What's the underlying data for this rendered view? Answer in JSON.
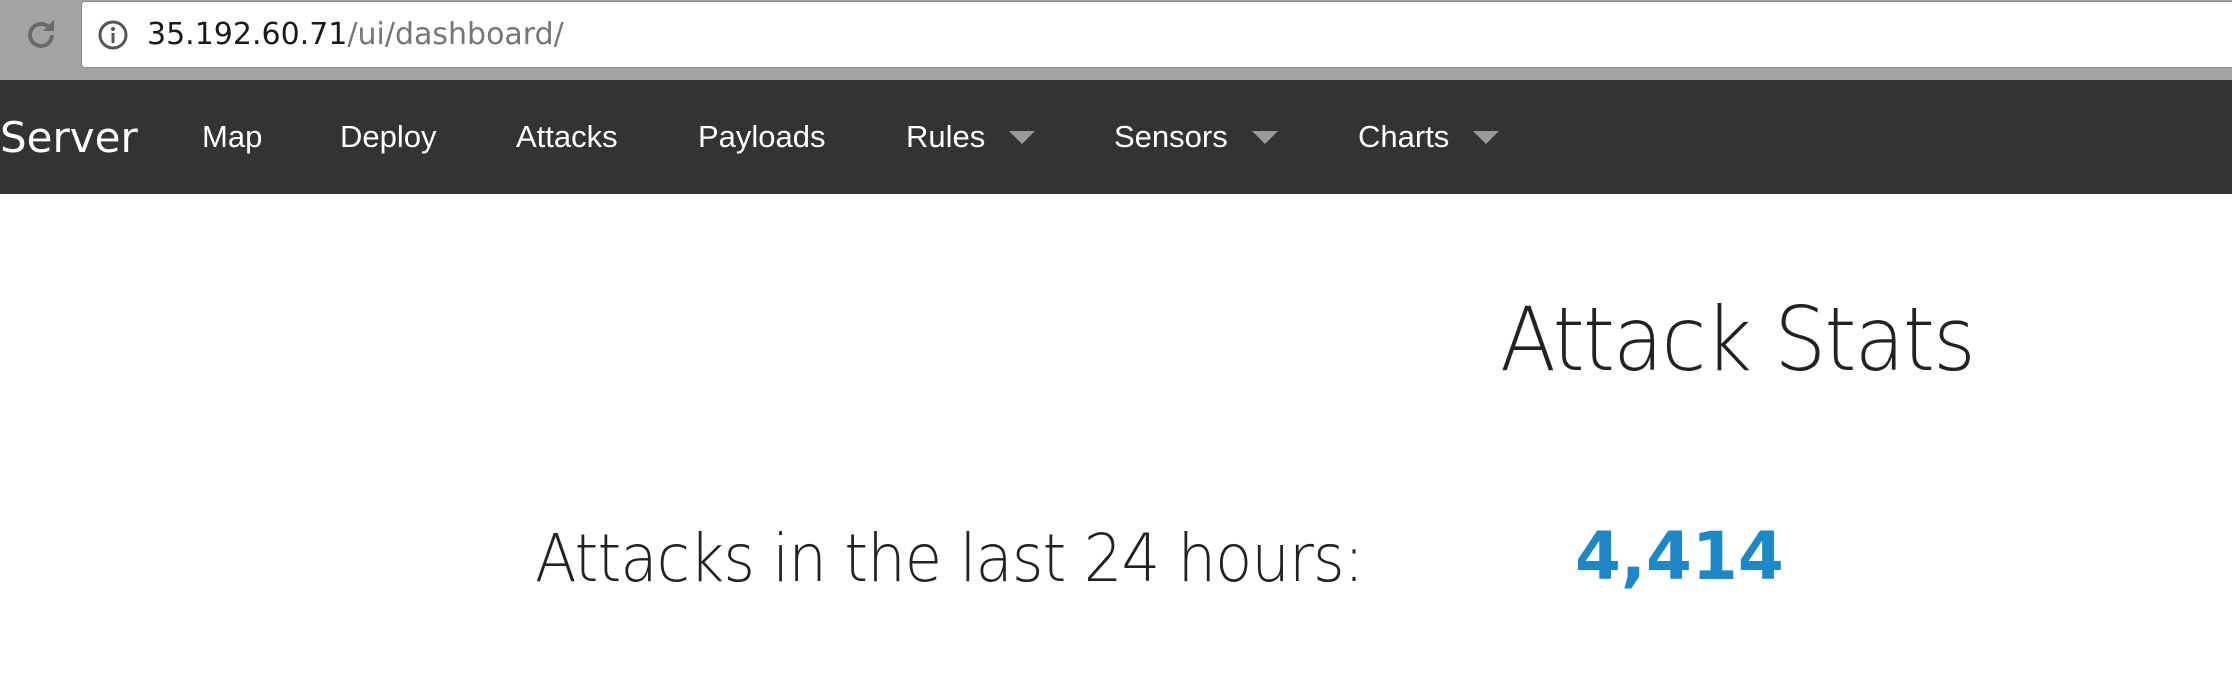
{
  "browser": {
    "url_host": "35.192.60.71",
    "url_path": "/ui/dashboard/"
  },
  "navbar": {
    "brand": "Server",
    "items": [
      {
        "label": "Map",
        "dropdown": false
      },
      {
        "label": "Deploy",
        "dropdown": false
      },
      {
        "label": "Attacks",
        "dropdown": false
      },
      {
        "label": "Payloads",
        "dropdown": false
      },
      {
        "label": "Rules",
        "dropdown": true
      },
      {
        "label": "Sensors",
        "dropdown": true
      },
      {
        "label": "Charts",
        "dropdown": true
      }
    ],
    "background": "#333333",
    "text_color": "#ffffff"
  },
  "main": {
    "title": "Attack Stats",
    "stat_label": "Attacks in the last 24 hours:",
    "stat_value": "4,414",
    "stat_value_color": "#1e88c6"
  }
}
